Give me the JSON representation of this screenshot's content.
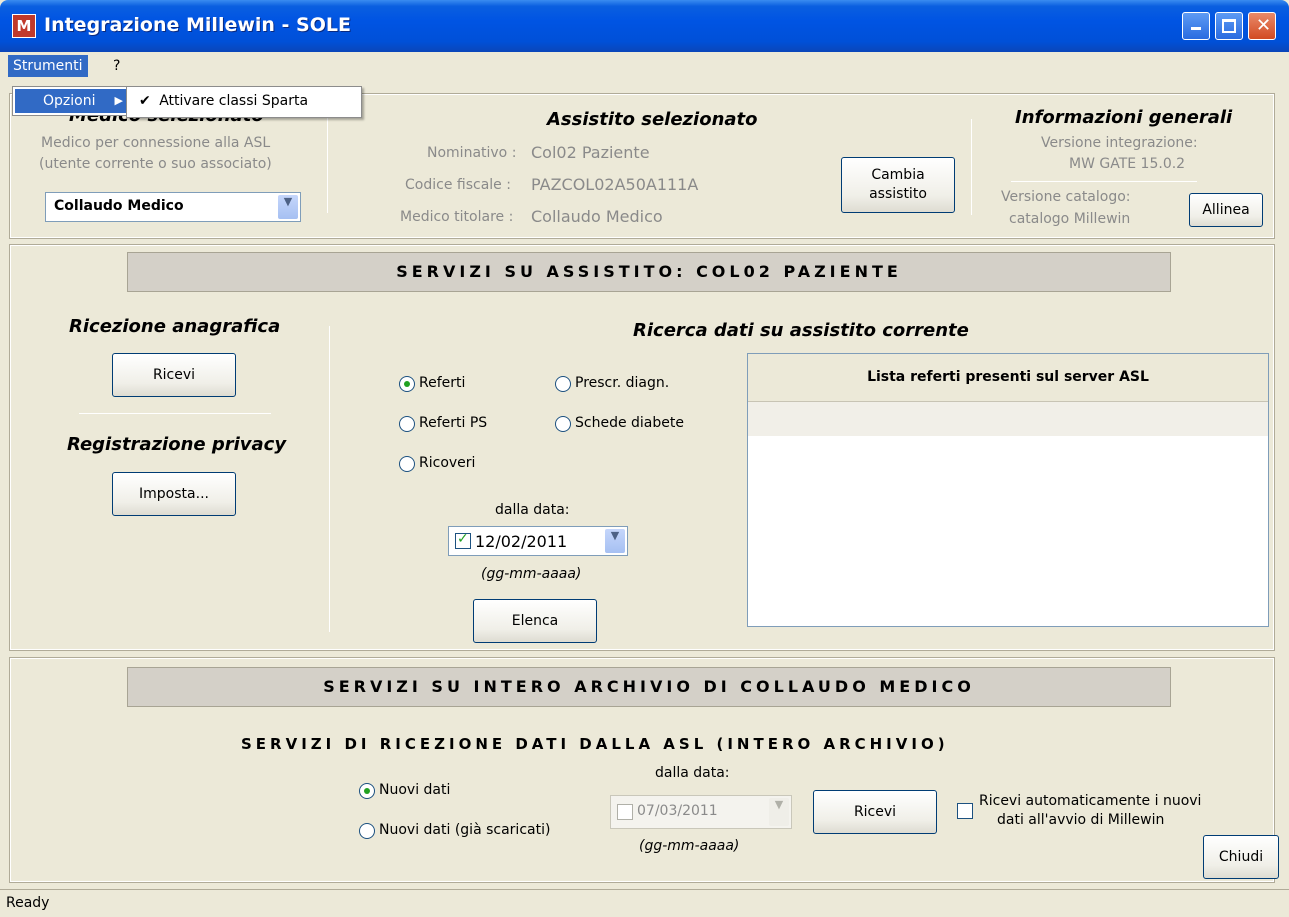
{
  "window": {
    "title": "Integrazione Millewin - SOLE",
    "app_icon": "M"
  },
  "menu": {
    "strumenti": "Strumenti",
    "help": "?",
    "opzioni": "Opzioni",
    "sub_check": "✔",
    "sub_item": "Attivare classi Sparta"
  },
  "medico": {
    "title": "Medico selezionato",
    "line1": "Medico per connessione alla ASL",
    "line2": "(utente corrente o suo associato)",
    "selected": "Collaudo Medico"
  },
  "assistito": {
    "title": "Assistito selezionato",
    "nominativo_label": "Nominativo :",
    "nominativo": "Col02 Paziente",
    "cf_label": "Codice fiscale :",
    "cf": "PAZCOL02A50A111A",
    "medico_label": "Medico titolare :",
    "medico": "Collaudo Medico",
    "cambia_line1": "Cambia",
    "cambia_line2": "assistito"
  },
  "info": {
    "title": "Informazioni generali",
    "versione_label": "Versione integrazione:",
    "versione": "MW GATE 15.0.2",
    "catalogo_label": "Versione catalogo:",
    "catalogo": "catalogo Millewin",
    "allinea": "Allinea"
  },
  "servizi_assistito": {
    "header": "SERVIZI SU ASSISTITO:   COL02 PAZIENTE",
    "ricezione_title": "Ricezione anagrafica",
    "ricevi": "Ricevi",
    "privacy_title": "Registrazione privacy",
    "imposta": "Imposta...",
    "ricerca_title": "Ricerca dati su assistito corrente",
    "radios": {
      "referti": "Referti",
      "referti_ps": "Referti PS",
      "ricoveri": "Ricoveri",
      "prescr": "Prescr. diagn.",
      "schede": "Schede diabete"
    },
    "selected_radio": "Referti",
    "dalla_data": "dalla data:",
    "date": "12/02/2011",
    "date_format": "(gg-mm-aaaa)",
    "elenca": "Elenca",
    "lista_header": "Lista referti presenti sul server ASL"
  },
  "servizi_archivio": {
    "header": "SERVIZI SU INTERO ARCHIVIO DI COLLAUDO MEDICO",
    "subheader": "SERVIZI DI RICEZIONE DATI DALLA ASL (INTERO ARCHIVIO)",
    "nuovi_dati": "Nuovi dati",
    "nuovi_dati_scaricati": "Nuovi dati (già scaricati)",
    "dalla_data": "dalla data:",
    "date": "07/03/2011",
    "date_format": "(gg-mm-aaaa)",
    "ricevi": "Ricevi",
    "auto_line1": "Ricevi automaticamente i nuovi",
    "auto_line2": "dati all'avvio di Millewin",
    "chiudi": "Chiudi"
  },
  "status": "Ready"
}
